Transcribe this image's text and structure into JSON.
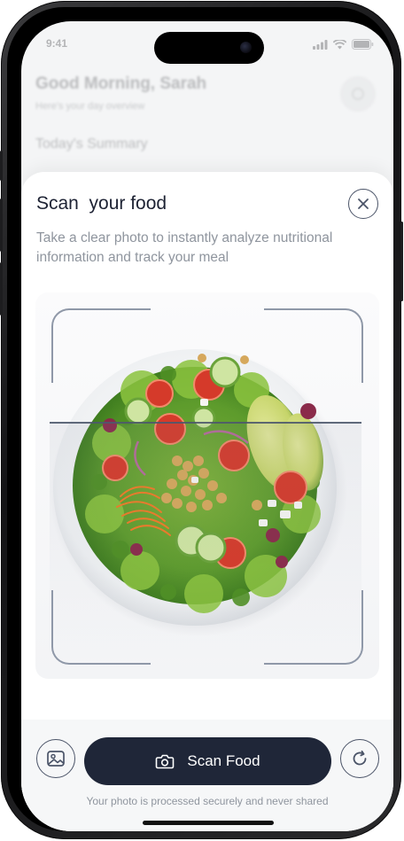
{
  "status_bar": {
    "time": "9:41",
    "icons": [
      "signal-icon",
      "wifi-icon",
      "battery-icon"
    ]
  },
  "background": {
    "greeting": "Good Morning, Sarah",
    "subtitle": "Here's your day overview",
    "summary_heading": "Today's Summary",
    "settings_icon": "gear-icon"
  },
  "sheet": {
    "title": "Scan  your food",
    "description": "Take a clear photo to instantly analyze nutritional information and track your meal",
    "close_icon": "close-icon"
  },
  "scan": {
    "image_subject": "salad-bowl-photo",
    "frame": "scan-frame-corners"
  },
  "actions": {
    "gallery_icon": "image-gallery-icon",
    "scan_label": "Scan Food",
    "scan_icon": "camera-icon",
    "retake_icon": "refresh-icon",
    "privacy_note": "Your photo is processed securely and never shared"
  },
  "colors": {
    "primary_button": "#1f2638",
    "icon_stroke": "#4b5468",
    "muted_text": "#8f959e",
    "scan_frame": "#8f98a8"
  }
}
